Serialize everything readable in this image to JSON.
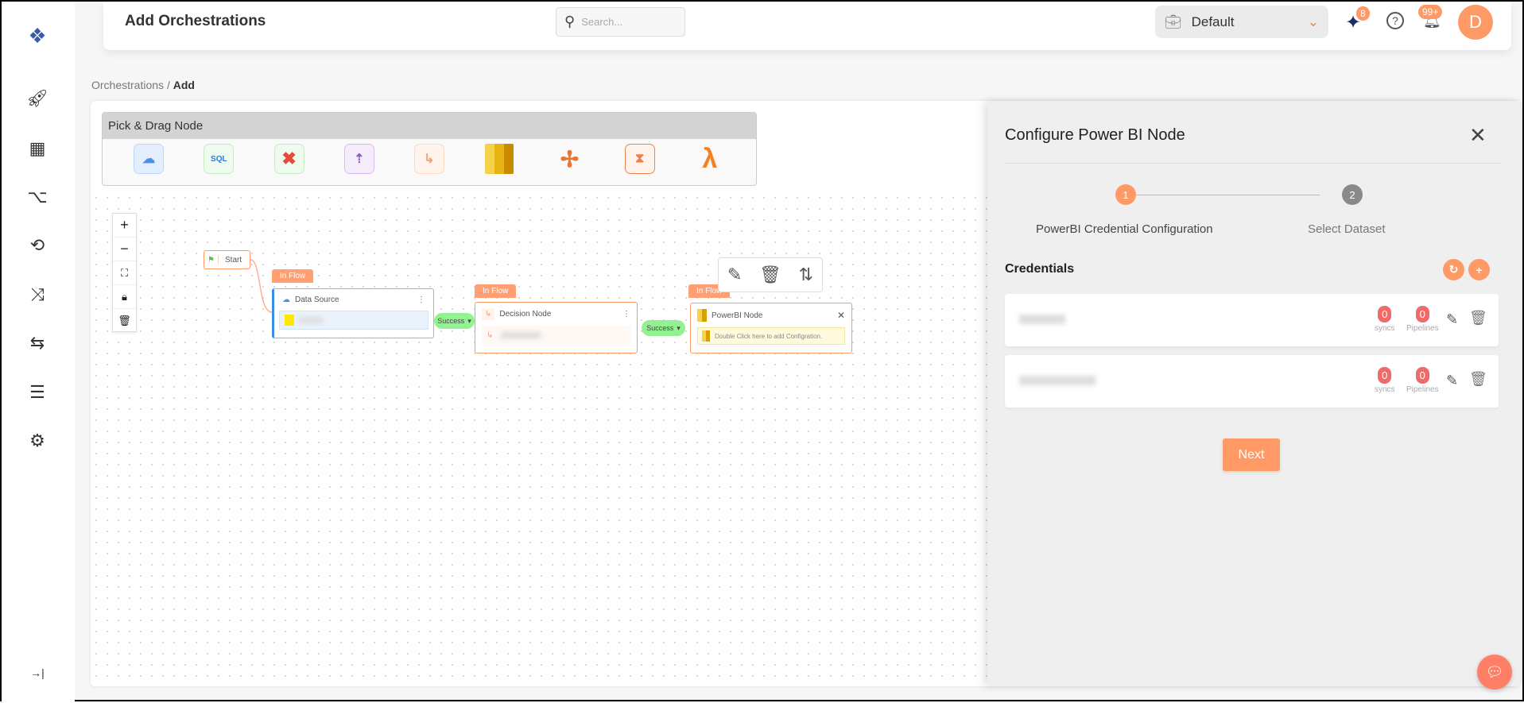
{
  "header": {
    "title": "Add Orchestrations",
    "search_placeholder": "Search...",
    "workspace": "Default",
    "ai_badge": "8",
    "notif_badge": "99+",
    "avatar_initial": "D"
  },
  "breadcrumb": {
    "parent": "Orchestrations",
    "separator": "/",
    "current": "Add"
  },
  "sidebar": {
    "items": [
      "rocket-icon",
      "dashboard-icon",
      "pipeline-icon",
      "sync-icon",
      "transform-icon",
      "orchestration-icon",
      "list-icon",
      "settings-icon"
    ]
  },
  "palette": {
    "title": "Pick & Drag Node",
    "items": [
      "data-source",
      "sql",
      "cross-transform",
      "cloud-upload",
      "decision",
      "powerbi",
      "tableau",
      "timer",
      "lambda"
    ]
  },
  "canvas": {
    "start_label": "Start",
    "nodes": [
      {
        "tag": "In Flow",
        "title": "Data Source"
      },
      {
        "tag": "In Flow",
        "title": "Decision Node"
      },
      {
        "tag": "In Flow",
        "title": "PowerBI Node",
        "hint": "Double Click here to add Configration."
      }
    ],
    "edge_label": "Success"
  },
  "panel": {
    "title": "Configure Power BI Node",
    "steps": [
      {
        "num": "1",
        "label": "PowerBI Credential Configuration",
        "active": true
      },
      {
        "num": "2",
        "label": "Select Dataset",
        "active": false
      }
    ],
    "section": "Credentials",
    "credentials": [
      {
        "syncs": "0",
        "pipelines": "0"
      },
      {
        "syncs": "0",
        "pipelines": "0"
      }
    ],
    "syncs_label": "syncs",
    "pipelines_label": "Pipelines",
    "next_label": "Next"
  },
  "colors": {
    "accent": "#ff9966",
    "success": "#92f190",
    "count": "#f06a6a"
  }
}
